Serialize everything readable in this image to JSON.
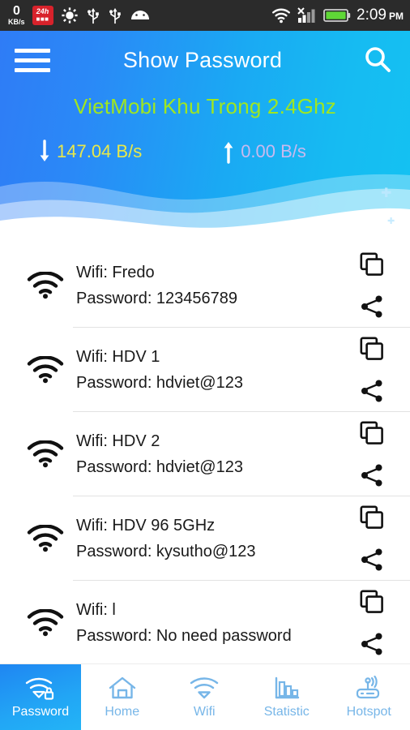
{
  "statusbar": {
    "net_speed_value": "0",
    "net_speed_unit": "KB/s",
    "badge_top": "24h",
    "badge_bottom": "■■■",
    "icons": [
      "brightness-sun-icon",
      "usb-icon",
      "usb-icon",
      "android-head-icon",
      "wifi-icon",
      "no-sim-signal-icon",
      "battery-icon"
    ],
    "time": "2:09",
    "ampm": "PM"
  },
  "header": {
    "menu_icon": "hamburger-menu-icon",
    "title": "Show Password",
    "search_icon": "search-icon",
    "ssid": "VietMobi Khu Trong 2.4Ghz",
    "download": {
      "arrow": "↓",
      "value": "147.04 B/s"
    },
    "upload": {
      "arrow": "↑",
      "value": "0.00 B/s"
    },
    "colors": {
      "gradient_left": "#2f7cf6",
      "gradient_right": "#14c2f2",
      "ssid_color": "#9fe621",
      "download_color": "#e8e84a",
      "upload_color": "#c9b9ef"
    }
  },
  "list": {
    "ssid_prefix": "Wifi: ",
    "password_prefix": "Password: ",
    "items": [
      {
        "ssid": "Wifi: Fredo",
        "password": "Password: 123456789"
      },
      {
        "ssid": "Wifi: HDV 1",
        "password": "Password: hdviet@123"
      },
      {
        "ssid": "Wifi: HDV 2",
        "password": "Password: hdviet@123"
      },
      {
        "ssid": "Wifi: HDV 96 5GHz",
        "password": "Password: kysutho@123"
      },
      {
        "ssid": "Wifi: l",
        "password": "Password: No need password"
      }
    ],
    "row_icons": {
      "wifi": "wifi-icon",
      "copy": "copy-icon",
      "share": "share-icon"
    }
  },
  "bottomnav": {
    "active_index": 0,
    "items": [
      {
        "label": "Password",
        "icon": "wifi-lock-icon"
      },
      {
        "label": "Home",
        "icon": "home-icon"
      },
      {
        "label": "Wifi",
        "icon": "wifi-icon"
      },
      {
        "label": "Statistic",
        "icon": "bar-chart-icon"
      },
      {
        "label": "Hotspot",
        "icon": "router-icon"
      }
    ],
    "active_bg": "#22a6f5",
    "inactive_color": "#77b6e8"
  }
}
